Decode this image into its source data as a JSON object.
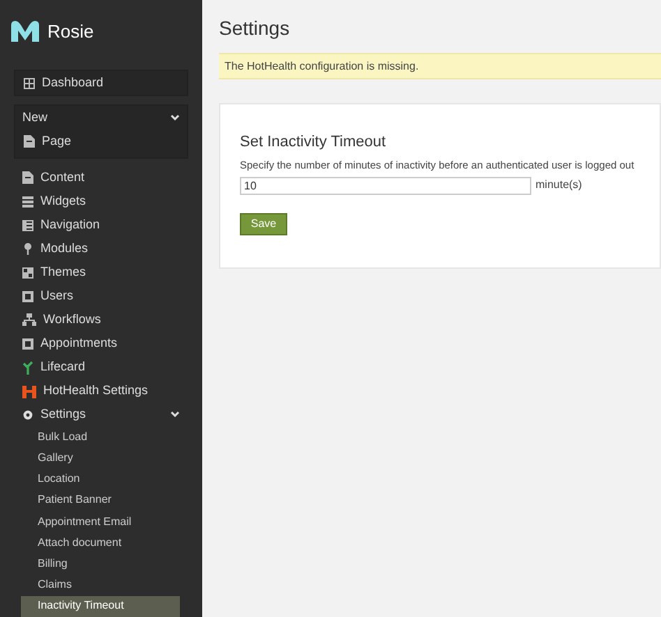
{
  "app": {
    "name": "Rosie"
  },
  "sidebar": {
    "dashboard": {
      "label": "Dashboard"
    },
    "new_group": {
      "label": "New",
      "expanded": true,
      "items": [
        {
          "label": "Page"
        }
      ]
    },
    "items": [
      {
        "label": "Content"
      },
      {
        "label": "Widgets"
      },
      {
        "label": "Navigation"
      },
      {
        "label": "Modules"
      },
      {
        "label": "Themes"
      },
      {
        "label": "Users"
      },
      {
        "label": "Workflows"
      },
      {
        "label": "Appointments"
      },
      {
        "label": "Lifecard"
      },
      {
        "label": "HotHealth Settings"
      },
      {
        "label": "Settings",
        "expanded": true,
        "children": [
          {
            "label": "Bulk Load",
            "selected": false
          },
          {
            "label": "Gallery",
            "selected": false
          },
          {
            "label": "Location",
            "selected": false
          },
          {
            "label": "Patient Banner",
            "selected": false
          },
          {
            "label": "Appointment Email",
            "selected": false
          },
          {
            "label": "Attach document",
            "selected": false
          },
          {
            "label": "Billing",
            "selected": false
          },
          {
            "label": "Claims",
            "selected": false
          },
          {
            "label": "Inactivity Timeout",
            "selected": true
          }
        ]
      }
    ]
  },
  "page": {
    "title": "Settings",
    "alert": "The HotHealth configuration is missing.",
    "card": {
      "heading": "Set Inactivity Timeout",
      "description": "Specify the number of minutes of inactivity before an authenticated user is logged out",
      "value": "10",
      "unit": "minute(s)",
      "button": "Save"
    }
  }
}
